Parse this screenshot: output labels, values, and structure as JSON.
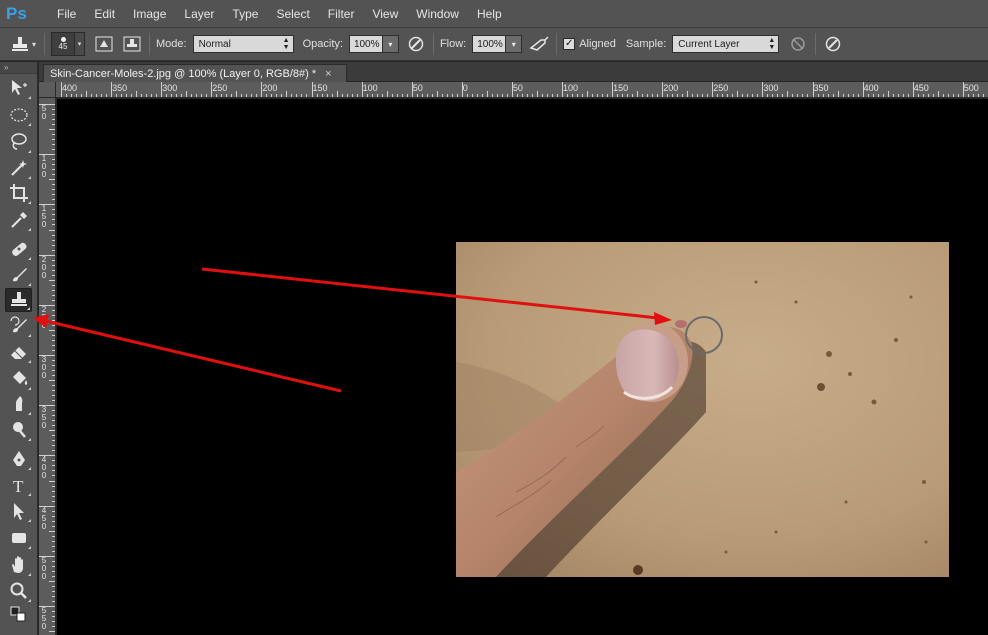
{
  "app": {
    "logo": "Ps"
  },
  "menu": [
    "File",
    "Edit",
    "Image",
    "Layer",
    "Type",
    "Select",
    "Filter",
    "View",
    "Window",
    "Help"
  ],
  "options": {
    "brush_size": "45",
    "mode_label": "Mode:",
    "mode_value": "Normal",
    "opacity_label": "Opacity:",
    "opacity_value": "100%",
    "flow_label": "Flow:",
    "flow_value": "100%",
    "aligned_label": "Aligned",
    "aligned_checked": true,
    "sample_label": "Sample:",
    "sample_value": "Current Layer"
  },
  "document": {
    "tab_title": "Skin-Cancer-Moles-2.jpg @ 100% (Layer 0, RGB/8#) *",
    "close_glyph": "×"
  },
  "ruler_top_labels": [
    "400",
    "350",
    "300",
    "250",
    "200",
    "150",
    "100",
    "50",
    "0",
    "50",
    "100",
    "150",
    "200",
    "250",
    "300",
    "350",
    "400",
    "450",
    "500"
  ],
  "ruler_left_labels": [
    "5\n0",
    "1\n0\n0",
    "1\n5\n0",
    "2\n0\n0",
    "2\n5\n0",
    "3\n0\n0",
    "3\n5\n0",
    "4\n0\n0",
    "4\n5\n0",
    "5\n0\n0",
    "5\n5\n0"
  ],
  "tools": [
    {
      "name": "move-tool-icon",
      "active": false
    },
    {
      "name": "elliptical-marquee-tool-icon",
      "active": false
    },
    {
      "name": "lasso-tool-icon",
      "active": false
    },
    {
      "name": "magic-wand-tool-icon",
      "active": false
    },
    {
      "name": "crop-tool-icon",
      "active": false
    },
    {
      "name": "eyedropper-tool-icon",
      "active": false
    },
    {
      "name": "healing-brush-tool-icon",
      "active": false
    },
    {
      "name": "brush-tool-icon",
      "active": false
    },
    {
      "name": "clone-stamp-tool-icon",
      "active": true
    },
    {
      "name": "history-brush-tool-icon",
      "active": false
    },
    {
      "name": "eraser-tool-icon",
      "active": false
    },
    {
      "name": "paint-bucket-tool-icon",
      "active": false
    },
    {
      "name": "smudge-tool-icon",
      "active": false
    },
    {
      "name": "dodge-tool-icon",
      "active": false
    },
    {
      "name": "pen-tool-icon",
      "active": false
    },
    {
      "name": "type-tool-icon",
      "active": false
    },
    {
      "name": "path-selection-tool-icon",
      "active": false
    },
    {
      "name": "rectangle-tool-icon",
      "active": false
    },
    {
      "name": "hand-tool-icon",
      "active": false
    },
    {
      "name": "zoom-tool-icon",
      "active": false
    },
    {
      "name": "default-colors-icon",
      "active": false
    }
  ],
  "type_tool_glyph": "T",
  "colors": {
    "arrow": "#e01010",
    "ui_panel": "#535353",
    "canvas": "#000000",
    "ps_blue": "#3aa0e8"
  }
}
